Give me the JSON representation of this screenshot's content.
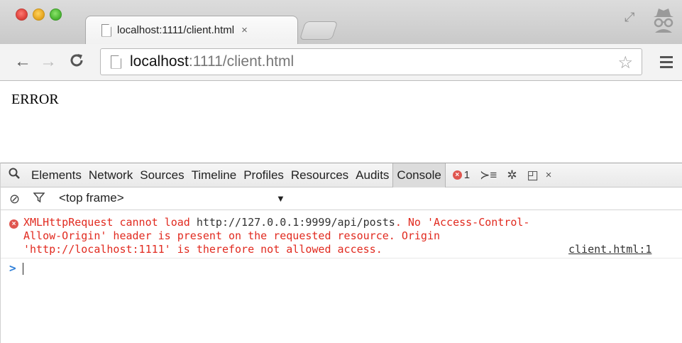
{
  "window": {
    "tab_title": "localhost:1111/client.html",
    "tab_close": "×"
  },
  "toolbar": {
    "url_host": "localhost",
    "url_rest": ":1111/client.html",
    "star": "☆"
  },
  "page": {
    "text": "ERROR"
  },
  "devtools": {
    "tabs": [
      "Elements",
      "Network",
      "Sources",
      "Timeline",
      "Profiles",
      "Resources",
      "Audits",
      "Console"
    ],
    "active_tab": "Console",
    "error_count": "1",
    "close": "×",
    "frame_selector": "<top frame>",
    "frame_caret": "▼"
  },
  "console": {
    "message_prefix": "XMLHttpRequest cannot load ",
    "message_url": "http://127.0.0.1:9999/api/posts",
    "message_line1_rest": ". No 'Access-Control-",
    "message_line2": "Allow-Origin' header is present on the requested resource. Origin",
    "message_line3": "'http://localhost:1111' is therefore not allowed access.",
    "source": "client.html:1",
    "prompt": ">"
  },
  "colors": {
    "error_red": "#e12a1f",
    "prompt_blue": "#2f7fd8"
  }
}
